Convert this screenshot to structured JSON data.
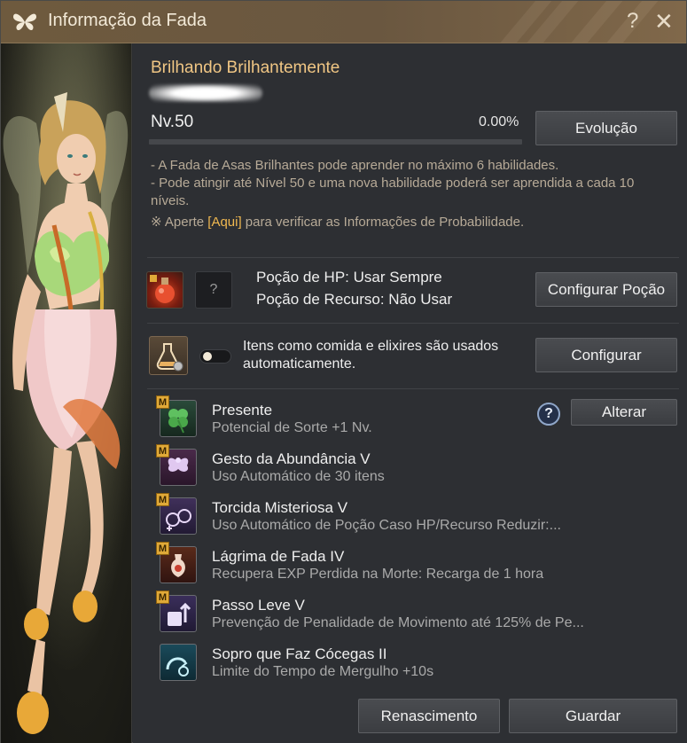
{
  "window": {
    "title": "Informação da Fada",
    "help_glyph": "?",
    "close_glyph": "✕"
  },
  "pet": {
    "name": "Brilhando Brilhantemente",
    "level": "Nv.50",
    "exp_percent": "0.00%",
    "exp_fraction": 0.0,
    "evolve_label": "Evolução"
  },
  "info": {
    "lines": [
      "- A Fada de Asas Brilhantes pode aprender no máximo 6 habilidades.",
      "- Pode atingir até Nível 50 e uma nova habilidade poderá ser aprendida a cada 10 níveis."
    ],
    "prob_prefix": "※ Aperte ",
    "prob_link": "[Aqui]",
    "prob_suffix": " para verificar as Informações de Probabilidade."
  },
  "potion": {
    "hp_label": "Poção de HP: Usar Sempre",
    "resource_label": "Poção de Recurso: Não Usar",
    "empty_slot": "?",
    "configure_label": "Configurar Poção"
  },
  "auto_use": {
    "text": "Itens como comida e elixires são usados automaticamente.",
    "toggle_on": false,
    "configure_label": "Configurar"
  },
  "skills": [
    {
      "badge": "M",
      "title": "Presente",
      "desc": "Potencial de Sorte +1 Nv.",
      "icon": "clover-icon"
    },
    {
      "badge": "M",
      "title": "Gesto da Abundância V",
      "desc": "Uso Automático de 30 itens",
      "icon": "fairy-icon"
    },
    {
      "badge": "M",
      "title": "Torcida Misteriosa V",
      "desc": "Uso Automático de Poção Caso HP/Recurso Reduzir:...",
      "icon": "potion-icon"
    },
    {
      "badge": "M",
      "title": "Lágrima de Fada IV",
      "desc": "Recupera EXP Perdida na Morte: Recarga de 1 hora",
      "icon": "vase-icon"
    },
    {
      "badge": "M",
      "title": "Passo Leve V",
      "desc": "Prevenção de Penalidade de Movimento até 125% de Pe...",
      "icon": "weight-icon"
    },
    {
      "badge": "",
      "title": "Sopro que Faz Cócegas II",
      "desc": "Limite do Tempo de Mergulho +10s",
      "icon": "breath-icon"
    }
  ],
  "skill_help": "?",
  "change_label": "Alterar",
  "footer": {
    "rebirth_label": "Renascimento",
    "store_label": "Guardar"
  },
  "colors": {
    "accent": "#f0c684",
    "link": "#f0b850",
    "title_bar": "#6e5a3e",
    "panel": "#2d2f33"
  }
}
